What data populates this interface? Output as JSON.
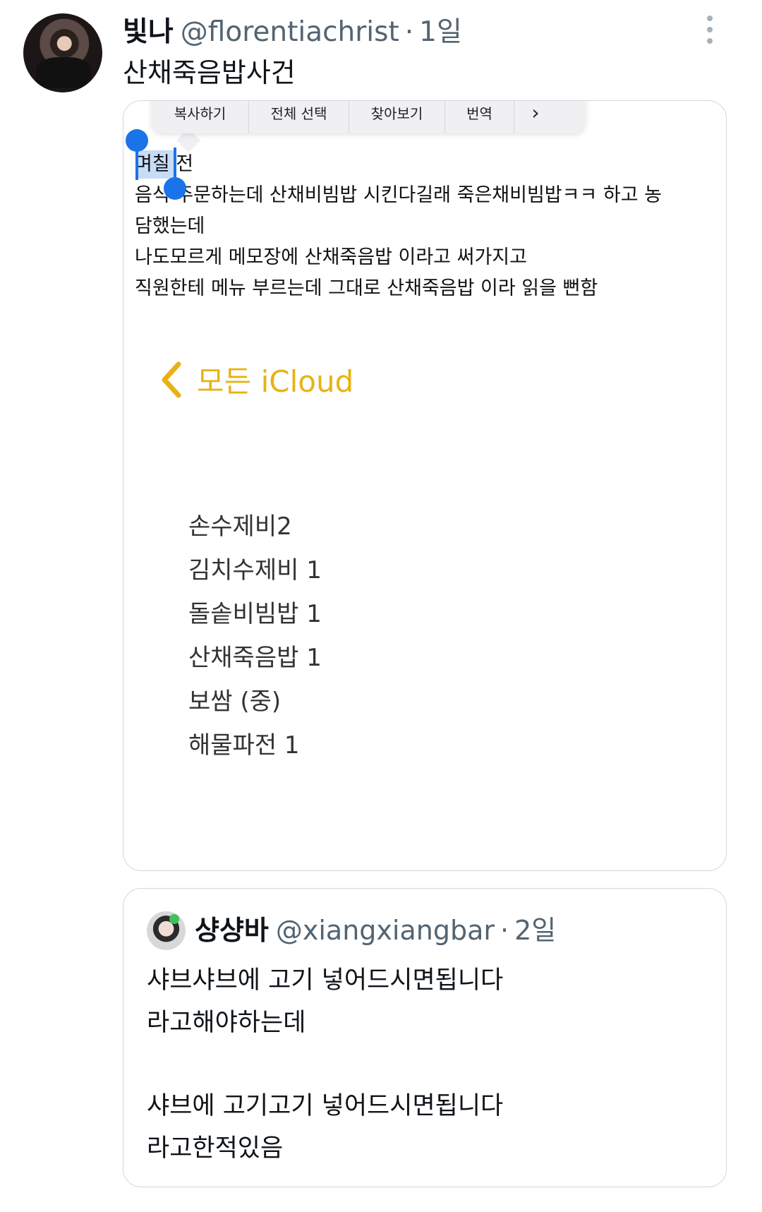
{
  "post": {
    "display_name": "빛나",
    "handle": "@florentiachrist",
    "separator": "·",
    "time": "1일",
    "text": "산채죽음밥사건"
  },
  "context_menu": {
    "items": [
      "복사하기",
      "전체 선택",
      "찾아보기",
      "번역",
      "›"
    ]
  },
  "note": {
    "lines": [
      "며칠 전",
      "음식 주문하는데 산채비빔밥 시킨다길래 죽은채비빔밥ㅋㅋ 하고 농",
      "담했는데",
      "나도모르게 메모장에 산채죽음밥 이라고 써가지고",
      "직원한테 메뉴 부르는데 그대로 산채죽음밥 이라 읽을 뻔함"
    ]
  },
  "icloud": {
    "label": "모든 iCloud",
    "color": "#e8b214"
  },
  "menu_items": [
    "손수제비2",
    "김치수제비 1",
    "돌솥비빔밥 1",
    "산채죽음밥 1",
    "보쌈 (중)",
    "해물파전 1"
  ],
  "quote": {
    "display_name": "샹샹바",
    "handle": "@xiangxiangbar",
    "separator": "·",
    "time": "2일",
    "paragraph1": [
      "샤브샤브에 고기 넣어드시면됩니다",
      "라고해야하는데"
    ],
    "paragraph2": [
      "샤브에 고기고기 넣어드시면됩니다",
      "라고한적있음"
    ]
  },
  "colors": {
    "handle_gray": "#536471",
    "selection_blue": "#1a73e8",
    "border": "#cfd9de"
  },
  "icons": [
    "avatar",
    "more-vertical-icon",
    "chevron-back-icon",
    "selection-handle"
  ]
}
